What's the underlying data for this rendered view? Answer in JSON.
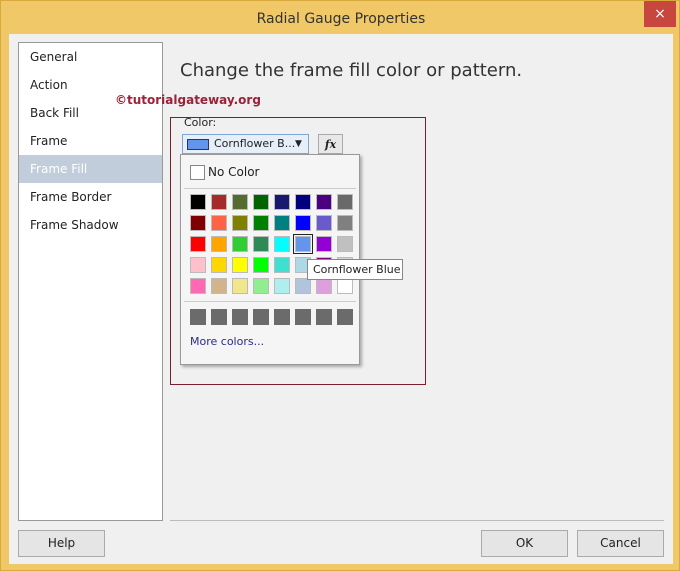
{
  "window": {
    "title": "Radial Gauge Properties",
    "close": "×"
  },
  "nav": [
    {
      "label": "General"
    },
    {
      "label": "Action"
    },
    {
      "label": "Back Fill"
    },
    {
      "label": "Frame"
    },
    {
      "label": "Frame Fill",
      "selected": true
    },
    {
      "label": "Frame Border"
    },
    {
      "label": "Frame Shadow"
    }
  ],
  "main": {
    "heading": "Change the frame fill color or pattern.",
    "watermark": "©tutorialgateway.org",
    "color_label": "Color:",
    "color_value": "Cornflower B...",
    "color_hex": "#6495ED",
    "fx": "fx"
  },
  "popup": {
    "no_color": "No Color",
    "more_colors": "More colors...",
    "tooltip": "Cornflower Blue",
    "palette": [
      [
        "#000000",
        "#A52A2A",
        "#556B2F",
        "#006400",
        "#191970",
        "#000080",
        "#4B0082",
        "#696969"
      ],
      [
        "#800000",
        "#FF6347",
        "#808000",
        "#008000",
        "#008080",
        "#0000FF",
        "#6A5ACD",
        "#808080"
      ],
      [
        "#FF0000",
        "#FFA500",
        "#32CD32",
        "#2E8B57",
        "#00FFFF",
        "#6495ED",
        "#9400D3",
        "#C0C0C0"
      ],
      [
        "#FFC0CB",
        "#FFD700",
        "#FFFF00",
        "#00FF00",
        "#40E0D0",
        "#ADD8E6",
        "#800080",
        "#D3D3D3"
      ],
      [
        "#FF69B4",
        "#D2B48C",
        "#F0E68C",
        "#90EE90",
        "#AFEEEE",
        "#B0C4DE",
        "#DDA0DD",
        "#FFFFFF"
      ]
    ],
    "selected_color": "#6495ED",
    "custom": [
      "#6B6B6B",
      "#6B6B6B",
      "#6B6B6B",
      "#6B6B6B",
      "#6B6B6B",
      "#6B6B6B",
      "#6B6B6B",
      "#6B6B6B"
    ]
  },
  "buttons": {
    "help": "Help",
    "ok": "OK",
    "cancel": "Cancel"
  }
}
